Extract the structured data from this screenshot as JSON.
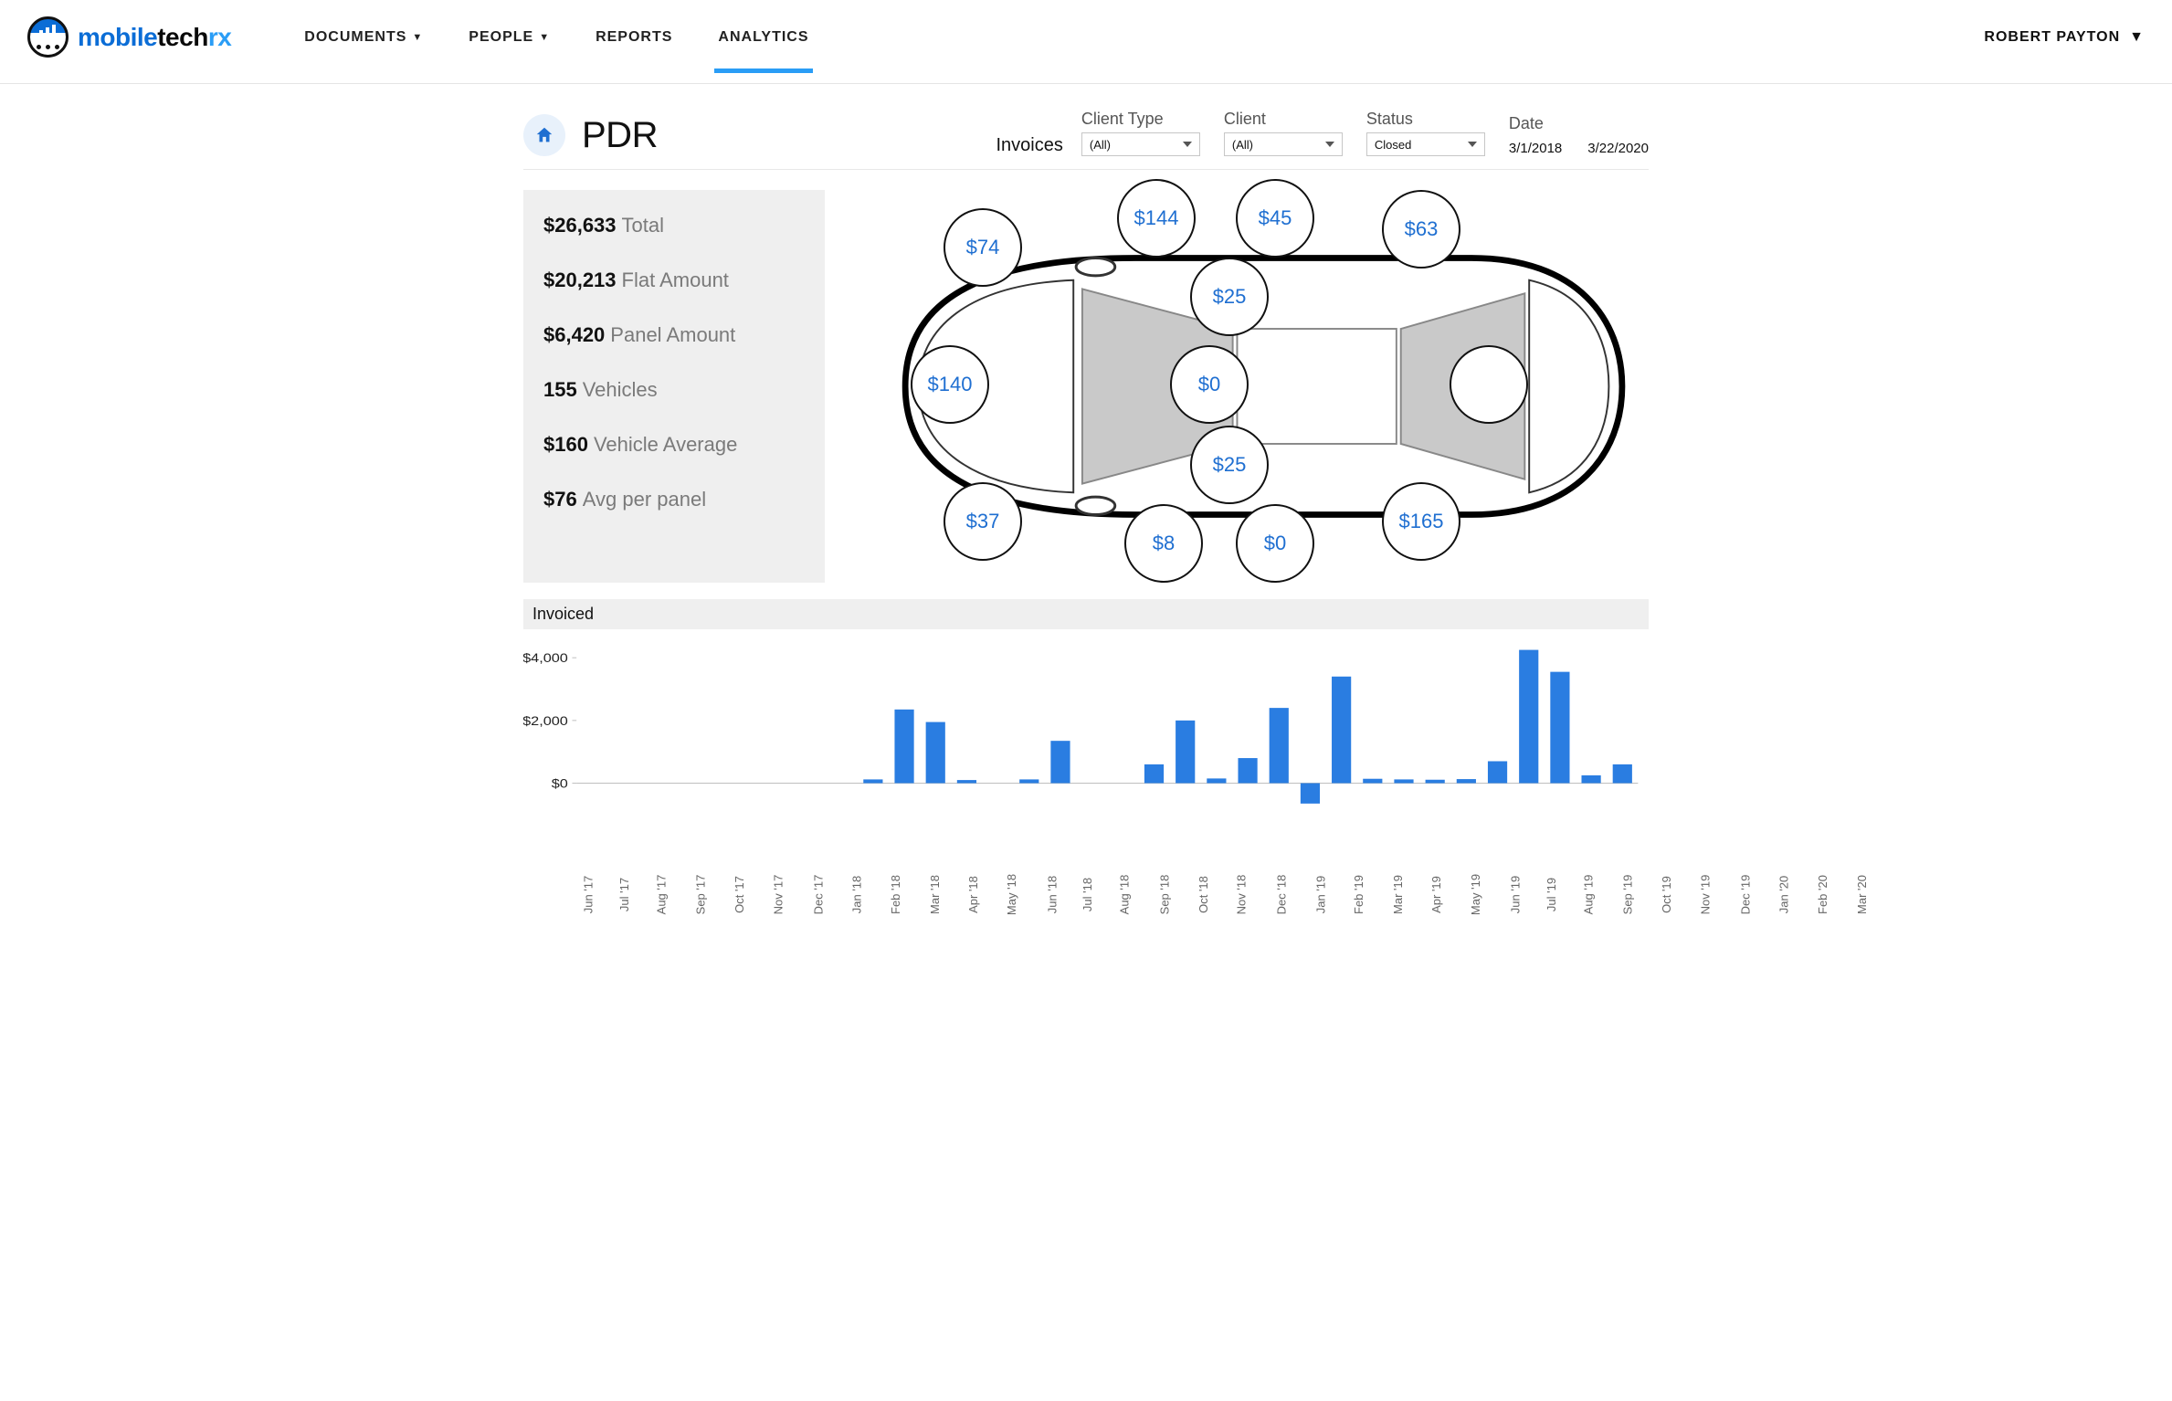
{
  "brand": {
    "p1": "mobile",
    "p2": "tech",
    "p3": "rx"
  },
  "nav": {
    "documents": "DOCUMENTS",
    "people": "PEOPLE",
    "reports": "REPORTS",
    "analytics": "ANALYTICS",
    "user": "ROBERT PAYTON"
  },
  "page": {
    "title": "PDR",
    "invoices_label": "Invoices"
  },
  "filters": {
    "client_type": {
      "label": "Client Type",
      "value": "(All)"
    },
    "client": {
      "label": "Client",
      "value": "(All)"
    },
    "status": {
      "label": "Status",
      "value": "Closed"
    },
    "date_label": "Date",
    "date_from": "3/1/2018",
    "date_to": "3/22/2020"
  },
  "stats": {
    "total": {
      "value": "$26,633",
      "label": "Total"
    },
    "flat": {
      "value": "$20,213",
      "label": "Flat Amount"
    },
    "panel": {
      "value": "$6,420",
      "label": "Panel Amount"
    },
    "vehicles": {
      "value": "155",
      "label": "Vehicles"
    },
    "veh_avg": {
      "value": "$160",
      "label": "Vehicle Average"
    },
    "panel_avg": {
      "value": "$76",
      "label": "Avg per panel"
    }
  },
  "panels": {
    "hood": "$74",
    "lf_fender": "$144",
    "lf_door": "$45",
    "lr_quarter": "$63",
    "l_roof_rail": "$25",
    "roof": "$0",
    "front_bumper": "$140",
    "r_roof_rail": "$25",
    "rf_fender": "$8",
    "rf_door": "$0",
    "rr_quarter": "$165",
    "cowl": "$37",
    "trunk": ""
  },
  "chart_title": "Invoiced",
  "chart_data": {
    "type": "bar",
    "title": "Invoiced",
    "xlabel": "",
    "ylabel": "",
    "ylim": [
      -800,
      4500
    ],
    "y_ticks": [
      "$0",
      "$2,000",
      "$4,000"
    ],
    "categories": [
      "Jun '17",
      "Jul '17",
      "Aug '17",
      "Sep '17",
      "Oct '17",
      "Nov '17",
      "Dec '17",
      "Jan '18",
      "Feb '18",
      "Mar '18",
      "Apr '18",
      "May '18",
      "Jun '18",
      "Jul '18",
      "Aug '18",
      "Sep '18",
      "Oct '18",
      "Nov '18",
      "Dec '18",
      "Jan '19",
      "Feb '19",
      "Mar '19",
      "Apr '19",
      "May '19",
      "Jun '19",
      "Jul '19",
      "Aug '19",
      "Sep '19",
      "Oct '19",
      "Nov '19",
      "Dec '19",
      "Jan '20",
      "Feb '20",
      "Mar '20"
    ],
    "values": [
      0,
      0,
      0,
      0,
      0,
      0,
      0,
      0,
      0,
      120,
      2350,
      1950,
      100,
      0,
      120,
      1350,
      0,
      0,
      600,
      2000,
      150,
      800,
      2400,
      -650,
      3400,
      140,
      120,
      110,
      130,
      700,
      4250,
      3550,
      250,
      600
    ]
  }
}
